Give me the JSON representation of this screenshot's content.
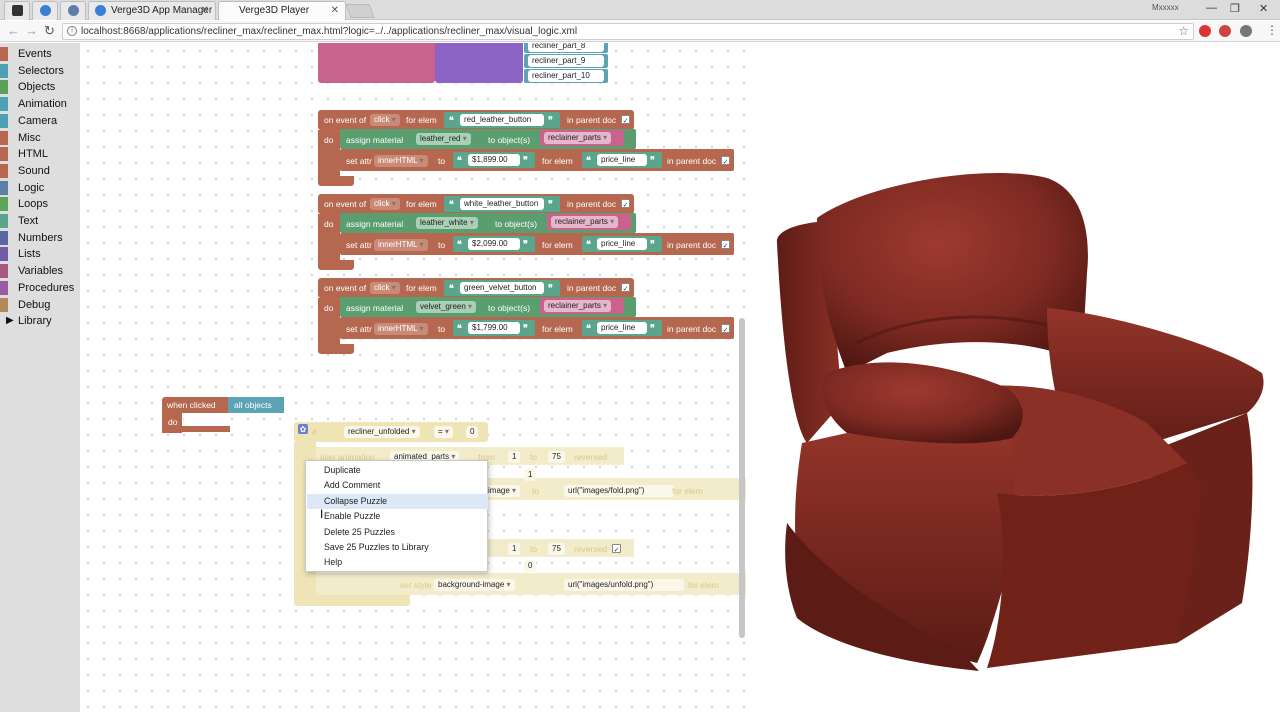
{
  "browser": {
    "tabs": [
      {
        "label": "Verge3D App Manager"
      },
      {
        "label": "Verge3D Player"
      }
    ],
    "window_user": "Mxxxxx",
    "url": "localhost:8668/applications/recliner_max/recliner_max.html?logic=../../applications/recliner_max/visual_logic.xml"
  },
  "toolbox": {
    "categories": [
      {
        "label": "Events",
        "color": "#b5684f"
      },
      {
        "label": "Selectors",
        "color": "#4ea0b4"
      },
      {
        "label": "Objects",
        "color": "#5c9e5c"
      },
      {
        "label": "Animation",
        "color": "#4ea0b4"
      },
      {
        "label": "Camera",
        "color": "#4ea0b4"
      },
      {
        "label": "Misc",
        "color": "#b5684f"
      },
      {
        "label": "HTML",
        "color": "#b5684f"
      },
      {
        "label": "Sound",
        "color": "#b5684f"
      },
      {
        "label": "Logic",
        "color": "#5b80a5"
      },
      {
        "label": "Loops",
        "color": "#5ba55b"
      },
      {
        "label": "Text",
        "color": "#5ba58c"
      },
      {
        "label": "Numbers",
        "color": "#5b67a5"
      },
      {
        "label": "Lists",
        "color": "#745ba5"
      },
      {
        "label": "Variables",
        "color": "#a55b80"
      },
      {
        "label": "Procedures",
        "color": "#995ba5"
      },
      {
        "label": "Debug",
        "color": "#b08a5a"
      },
      {
        "label": "Library",
        "color": ""
      }
    ]
  },
  "puzzles": {
    "top_list": [
      "recliner_part_8",
      "recliner_part_9",
      "recliner_part_10"
    ],
    "events": [
      {
        "on_event": "on event of",
        "event": "click",
        "for_elem": "for elem",
        "elem": "red_leather_button",
        "in_parent": "in parent doc",
        "assign": "assign material",
        "material": "leather_red",
        "to_objects": "to object(s)",
        "objects": "reclainer_parts",
        "set_attr": "set attr",
        "attr": "innerHTML",
        "to": "to",
        "price": "$1,899.00",
        "for_elem2": "for elem",
        "target": "price_line",
        "in_parent2": "in parent doc"
      },
      {
        "on_event": "on event of",
        "event": "click",
        "for_elem": "for elem",
        "elem": "white_leather_button",
        "in_parent": "in parent doc",
        "assign": "assign material",
        "material": "leather_white",
        "to_objects": "to object(s)",
        "objects": "reclainer_parts",
        "set_attr": "set attr",
        "attr": "innerHTML",
        "to": "to",
        "price": "$2,099.00",
        "for_elem2": "for elem",
        "target": "price_line",
        "in_parent2": "in parent doc"
      },
      {
        "on_event": "on event of",
        "event": "click",
        "for_elem": "for elem",
        "elem": "green_velvet_button",
        "in_parent": "in parent doc",
        "assign": "assign material",
        "material": "velvet_green",
        "to_objects": "to object(s)",
        "objects": "reclainer_parts",
        "set_attr": "set attr",
        "attr": "innerHTML",
        "to": "to",
        "price": "$1,799.00",
        "for_elem2": "for elem",
        "target": "price_line",
        "in_parent2": "in parent doc"
      }
    ],
    "do_label": "do",
    "when_clicked": {
      "label": "when clicked",
      "target": "all objects",
      "do": "do"
    },
    "if_block": {
      "if": "if",
      "var": "recliner_unfolded",
      "op": "=",
      "value": "0",
      "play": "play animation",
      "anim": "animated_parts",
      "from": "from",
      "from_val": "1",
      "to": "to",
      "to_val": "75",
      "reversed": "reversed",
      "one": "1",
      "image": "image",
      "set_to": "to",
      "fold_url": "url(\"images/fold.png\")",
      "for_elem": "for elem",
      "anim2_from": "1",
      "anim2_to": "75",
      "zero": "0",
      "set_style": "set style",
      "style": "background-image",
      "unfold_url": "url(\"images/unfold.png\")"
    }
  },
  "context_menu": {
    "items": [
      "Duplicate",
      "Add Comment",
      "Collapse Puzzle",
      "Enable Puzzle",
      "Delete 25 Puzzles",
      "Save 25 Puzzles to Library",
      "Help"
    ],
    "highlighted": "Collapse Puzzle"
  },
  "colors": {
    "events": "#b5684f",
    "materials": "#5a9e70",
    "objects_list": "#5ba3b5",
    "text": "#5ba58c",
    "disabled": "#efe4b5"
  }
}
